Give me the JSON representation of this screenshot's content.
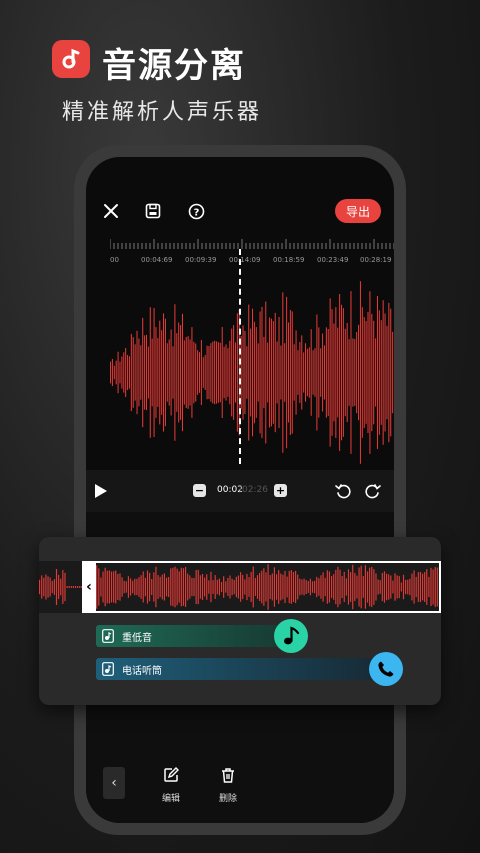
{
  "hero": {
    "title": "音源分离",
    "subtitle": "精准解析人声乐器"
  },
  "app": {
    "export_label": "导出",
    "topbar_icons": [
      "close-icon",
      "save-icon",
      "help-icon"
    ]
  },
  "timeline": {
    "ticks": [
      "00",
      "00:04:69",
      "00:09:39",
      "00:14:09",
      "00:18:59",
      "00:23:49",
      "00:28:19"
    ]
  },
  "playback": {
    "current_time": "00:02",
    "total_time": "/02:26"
  },
  "tracks": [
    {
      "label": "重低音",
      "action_icon": "music-note-icon"
    },
    {
      "label": "电话听筒",
      "action_icon": "phone-icon"
    }
  ],
  "bottom_toolbar": {
    "back_label": "‹",
    "items": [
      {
        "label": "编辑",
        "icon": "edit-icon"
      },
      {
        "label": "删除",
        "icon": "trash-icon"
      }
    ]
  },
  "colors": {
    "accent": "#e8433f",
    "waveform": "#e03a36",
    "track_green": "#1f6a55",
    "track_blue": "#1f5f7a",
    "music_btn": "#29d3a6",
    "phone_btn": "#3bb6f0"
  }
}
